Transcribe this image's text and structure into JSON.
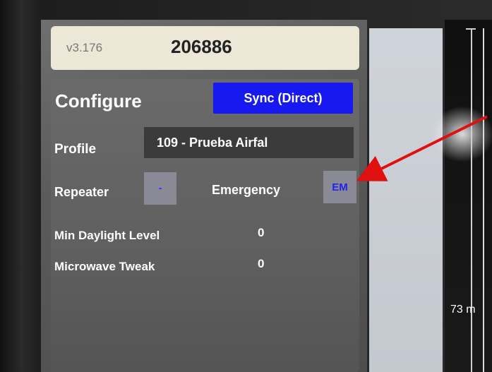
{
  "header": {
    "version": "v3.176",
    "serial": "206886"
  },
  "configure": {
    "title": "Configure",
    "sync_button": "Sync (Direct)",
    "profile_label": "Profile",
    "profile_value": "109 - Prueba Airfal",
    "repeater_label": "Repeater",
    "repeater_button": "-",
    "emergency_label": "Emergency",
    "em_button": "EM",
    "min_daylight_label": "Min Daylight Level",
    "min_daylight_value": "0",
    "microwave_label": "Microwave Tweak",
    "microwave_value": "0"
  },
  "side": {
    "distance": "73 m"
  },
  "colors": {
    "sync_button": "#1818f0",
    "annotation_arrow": "#e01010"
  }
}
